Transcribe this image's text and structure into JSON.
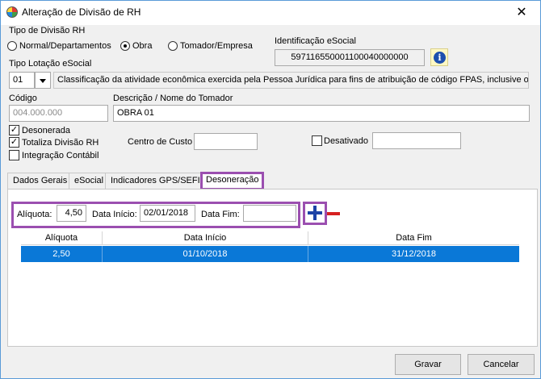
{
  "window": {
    "title": "Alteração de Divisão de RH",
    "close_glyph": "✕"
  },
  "tipo_divisao": {
    "label": "Tipo de Divisão RH",
    "options": [
      {
        "label": "Normal/Departamentos",
        "selected": false
      },
      {
        "label": "Obra",
        "selected": true
      },
      {
        "label": "Tomador/Empresa",
        "selected": false
      }
    ]
  },
  "identificacao": {
    "label": "Identificação eSocial",
    "value": "597116550001100040000000",
    "info_icon": "i"
  },
  "tipo_lotacao": {
    "label": "Tipo Lotação eSocial",
    "code": "01",
    "description": "Classificação da atividade econômica exercida pela Pessoa Jurídica para fins de atribuição de código FPAS, inclusive obras"
  },
  "codigo": {
    "label": "Código",
    "value": "004.000.000"
  },
  "descricao": {
    "label": "Descrição / Nome do Tomador",
    "value": "OBRA 01"
  },
  "checks": {
    "desonerada": {
      "label": "Desonerada",
      "checked": true
    },
    "totaliza": {
      "label": "Totaliza Divisão RH",
      "checked": true
    },
    "integracao": {
      "label": "Integração Contábil",
      "checked": false
    },
    "desativado": {
      "label": "Desativado",
      "checked": false
    }
  },
  "centro_custo": {
    "label": "Centro de Custo",
    "value": ""
  },
  "tabs": [
    "Dados Gerais",
    "eSocial",
    "Indicadores GPS/SEFIP",
    "Desoneração"
  ],
  "active_tab": "Desoneração",
  "desoneracao": {
    "aliquota_label": "Alíquota:",
    "aliquota_value": "4,50",
    "data_inicio_label": "Data Início:",
    "data_inicio_value": "02/01/2018",
    "data_fim_label": "Data Fim:",
    "data_fim_value": "",
    "columns": [
      "Alíquota",
      "Data Início",
      "Data Fim"
    ],
    "rows": [
      {
        "aliquota": "2,50",
        "data_inicio": "01/10/2018",
        "data_fim": "31/12/2018",
        "selected": true
      }
    ]
  },
  "buttons": {
    "gravar": "Gravar",
    "cancelar": "Cancelar"
  },
  "colors": {
    "highlight": "#9b4fb0",
    "selection": "#0a78d7",
    "plus": "#1d43a6",
    "minus": "#d62020"
  }
}
